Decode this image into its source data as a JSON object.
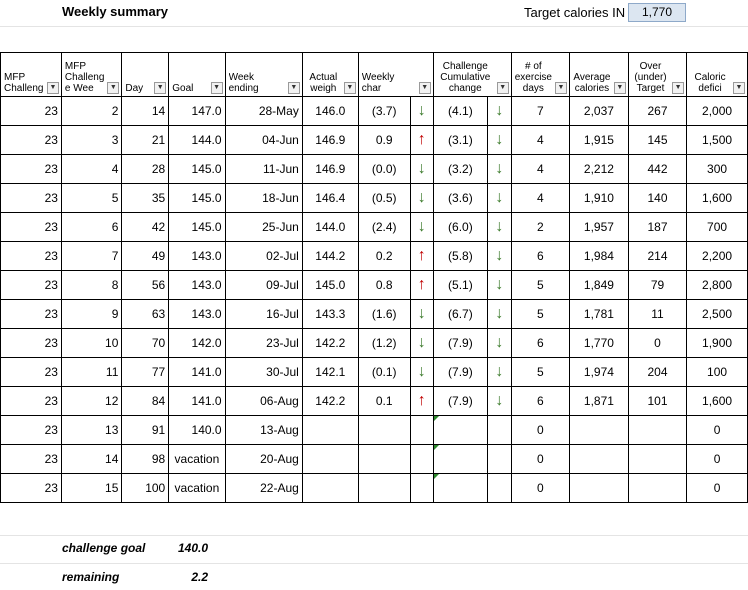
{
  "title": "Weekly summary",
  "target": {
    "label": "Target calories IN",
    "value": "1,770"
  },
  "columns": [
    "MFP Challeng",
    "MFP Challeng e Wee",
    "Day",
    "Goal",
    "Week ending",
    "Actual weigh",
    "Weekly char",
    "",
    "Challenge Cumulative change",
    "",
    "# of exercise days",
    "Average calories",
    "Over (under) Target",
    "Caloric defici"
  ],
  "rows": [
    {
      "ch": "23",
      "wk": "2",
      "day": "14",
      "goal": "147.0",
      "week": "28-May",
      "actual": "146.0",
      "weekly": "(3.7)",
      "wdir": "down",
      "cum": "(4.1)",
      "cdir": "down",
      "ex": "7",
      "avg": "2,037",
      "over": "267",
      "def": "2,000"
    },
    {
      "ch": "23",
      "wk": "3",
      "day": "21",
      "goal": "144.0",
      "week": "04-Jun",
      "actual": "146.9",
      "weekly": "0.9",
      "wdir": "up",
      "cum": "(3.1)",
      "cdir": "down",
      "ex": "4",
      "avg": "1,915",
      "over": "145",
      "def": "1,500"
    },
    {
      "ch": "23",
      "wk": "4",
      "day": "28",
      "goal": "145.0",
      "week": "11-Jun",
      "actual": "146.9",
      "weekly": "(0.0)",
      "wdir": "down",
      "cum": "(3.2)",
      "cdir": "down",
      "ex": "4",
      "avg": "2,212",
      "over": "442",
      "def": "300"
    },
    {
      "ch": "23",
      "wk": "5",
      "day": "35",
      "goal": "145.0",
      "week": "18-Jun",
      "actual": "146.4",
      "weekly": "(0.5)",
      "wdir": "down",
      "cum": "(3.6)",
      "cdir": "down",
      "ex": "4",
      "avg": "1,910",
      "over": "140",
      "def": "1,600"
    },
    {
      "ch": "23",
      "wk": "6",
      "day": "42",
      "goal": "145.0",
      "week": "25-Jun",
      "actual": "144.0",
      "weekly": "(2.4)",
      "wdir": "down",
      "cum": "(6.0)",
      "cdir": "down",
      "ex": "2",
      "avg": "1,957",
      "over": "187",
      "def": "700"
    },
    {
      "ch": "23",
      "wk": "7",
      "day": "49",
      "goal": "143.0",
      "week": "02-Jul",
      "actual": "144.2",
      "weekly": "0.2",
      "wdir": "up",
      "cum": "(5.8)",
      "cdir": "down",
      "ex": "6",
      "avg": "1,984",
      "over": "214",
      "def": "2,200"
    },
    {
      "ch": "23",
      "wk": "8",
      "day": "56",
      "goal": "143.0",
      "week": "09-Jul",
      "actual": "145.0",
      "weekly": "0.8",
      "wdir": "up",
      "cum": "(5.1)",
      "cdir": "down",
      "ex": "5",
      "avg": "1,849",
      "over": "79",
      "def": "2,800"
    },
    {
      "ch": "23",
      "wk": "9",
      "day": "63",
      "goal": "143.0",
      "week": "16-Jul",
      "actual": "143.3",
      "weekly": "(1.6)",
      "wdir": "down",
      "cum": "(6.7)",
      "cdir": "down",
      "ex": "5",
      "avg": "1,781",
      "over": "11",
      "def": "2,500"
    },
    {
      "ch": "23",
      "wk": "10",
      "day": "70",
      "goal": "142.0",
      "week": "23-Jul",
      "actual": "142.2",
      "weekly": "(1.2)",
      "wdir": "down",
      "cum": "(7.9)",
      "cdir": "down",
      "ex": "6",
      "avg": "1,770",
      "over": "0",
      "def": "1,900"
    },
    {
      "ch": "23",
      "wk": "11",
      "day": "77",
      "goal": "141.0",
      "week": "30-Jul",
      "actual": "142.1",
      "weekly": "(0.1)",
      "wdir": "down",
      "cum": "(7.9)",
      "cdir": "down",
      "ex": "5",
      "avg": "1,974",
      "over": "204",
      "def": "100"
    },
    {
      "ch": "23",
      "wk": "12",
      "day": "84",
      "goal": "141.0",
      "week": "06-Aug",
      "actual": "142.2",
      "weekly": "0.1",
      "wdir": "up",
      "cum": "(7.9)",
      "cdir": "down",
      "ex": "6",
      "avg": "1,871",
      "over": "101",
      "def": "1,600"
    },
    {
      "ch": "23",
      "wk": "13",
      "day": "91",
      "goal": "140.0",
      "week": "13-Aug",
      "actual": "",
      "weekly": "",
      "wdir": "",
      "cum": "",
      "cdir": "",
      "ex": "0",
      "avg": "",
      "over": "",
      "def": "0"
    },
    {
      "ch": "23",
      "wk": "14",
      "day": "98",
      "goal": "vacation",
      "week": "20-Aug",
      "actual": "",
      "weekly": "",
      "wdir": "",
      "cum": "",
      "cdir": "",
      "ex": "0",
      "avg": "",
      "over": "",
      "def": "0"
    },
    {
      "ch": "23",
      "wk": "15",
      "day": "100",
      "goal": "vacation",
      "week": "22-Aug",
      "actual": "",
      "weekly": "",
      "wdir": "",
      "cum": "",
      "cdir": "",
      "ex": "0",
      "avg": "",
      "over": "",
      "def": "0"
    }
  ],
  "footer": {
    "challenge_goal_label": "challenge goal",
    "challenge_goal_value": "140.0",
    "remaining_label": "remaining",
    "remaining_value": "2.2"
  },
  "colors": {
    "up_arrow": "#c00000",
    "down_arrow": "#3b7a2a",
    "target_fill": "#dce6f1"
  },
  "icons": {
    "up": "up-arrow-icon",
    "down": "down-arrow-icon",
    "filter": "filter-dropdown-icon"
  }
}
